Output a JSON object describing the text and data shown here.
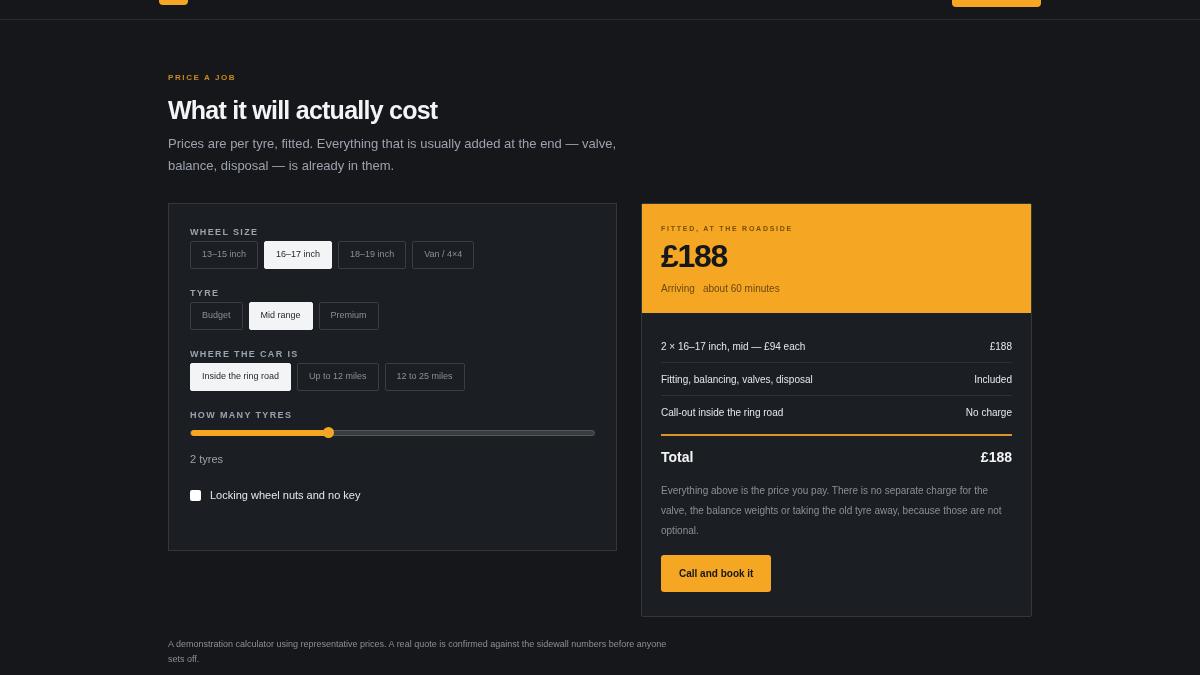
{
  "eyebrow": "PRICE A JOB",
  "title": "What it will actually cost",
  "intro": "Prices are per tyre, fitted. Everything that is usually added at the end — valve, balance, disposal — is already in them.",
  "groups": [
    {
      "label": "WHEEL SIZE",
      "options": [
        {
          "label": "13–15 inch",
          "selected": false
        },
        {
          "label": "16–17 inch",
          "selected": true
        },
        {
          "label": "18–19 inch",
          "selected": false
        },
        {
          "label": "Van / 4×4",
          "selected": false
        }
      ]
    },
    {
      "label": "TYRE",
      "options": [
        {
          "label": "Budget",
          "selected": false
        },
        {
          "label": "Mid range",
          "selected": true
        },
        {
          "label": "Premium",
          "selected": false
        }
      ]
    },
    {
      "label": "WHERE THE CAR IS",
      "options": [
        {
          "label": "Inside the ring road",
          "selected": true
        },
        {
          "label": "Up to 12 miles",
          "selected": false
        },
        {
          "label": "12 to 25 miles",
          "selected": false
        }
      ]
    }
  ],
  "tyres": {
    "label": "HOW MANY TYRES",
    "level": 0.34,
    "reading": "2 tyres"
  },
  "locking_nuts": {
    "label": "Locking wheel nuts and no key",
    "checked": false
  },
  "quote": {
    "eyebrow": "FITTED, AT THE ROADSIDE",
    "price": "£188",
    "arriving_label": "Arriving",
    "arriving": "about 60 minutes",
    "lines": [
      {
        "label": "2 × 16–17 inch, mid — £94 each",
        "value": "£188"
      },
      {
        "label": "Fitting, balancing, valves, disposal",
        "value": "Included"
      },
      {
        "label": "Call-out inside the ring road",
        "value": "No charge"
      }
    ],
    "total_label": "Total",
    "total": "£188",
    "note": "Everything above is the price you pay. There is no separate charge for the valve, the balance weights or taking the old tyre away, because those are not optional.",
    "button": "Call and book it"
  },
  "footnote": "A demonstration calculator using representative prices. A real quote is confirmed against the sidewall numbers before anyone sets off."
}
